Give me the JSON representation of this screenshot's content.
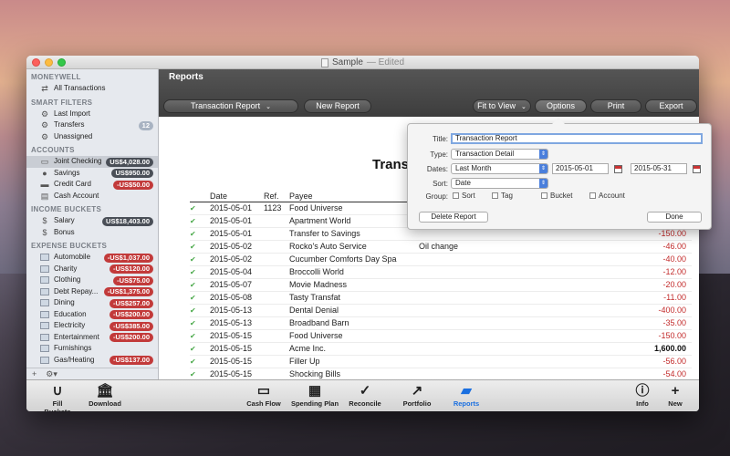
{
  "window": {
    "title": "Sample",
    "title_status": "— Edited"
  },
  "sidebar": {
    "app_header": "MONEYWELL",
    "all_transactions": "All Transactions",
    "smart_filters_header": "SMART FILTERS",
    "smart_filters": [
      {
        "label": "Last Import",
        "icon": "gear-icon"
      },
      {
        "label": "Transfers",
        "icon": "gear-icon",
        "count": "12"
      },
      {
        "label": "Unassigned",
        "icon": "gear-icon"
      }
    ],
    "accounts_header": "ACCOUNTS",
    "accounts": [
      {
        "label": "Joint Checking",
        "amount": "US$4,028.00",
        "tone": "dark",
        "icon": "checkbook-icon"
      },
      {
        "label": "Savings",
        "amount": "US$950.00",
        "tone": "dark",
        "icon": "piggy-bank-icon"
      },
      {
        "label": "Credit Card",
        "amount": "-US$50.00",
        "tone": "red",
        "icon": "credit-card-icon"
      },
      {
        "label": "Cash Account",
        "amount": "",
        "tone": "",
        "icon": "cash-icon"
      }
    ],
    "income_header": "INCOME BUCKETS",
    "income": [
      {
        "label": "Salary",
        "amount": "US$18,403.00",
        "tone": "dark"
      },
      {
        "label": "Bonus",
        "amount": "",
        "tone": ""
      }
    ],
    "expense_header": "EXPENSE BUCKETS",
    "expenses": [
      {
        "label": "Automobile",
        "amount": "-US$1,037.00",
        "tone": "red"
      },
      {
        "label": "Charity",
        "amount": "-US$120.00",
        "tone": "red"
      },
      {
        "label": "Clothing",
        "amount": "-US$75.00",
        "tone": "red"
      },
      {
        "label": "Debt Repay...",
        "amount": "-US$1,375.00",
        "tone": "red"
      },
      {
        "label": "Dining",
        "amount": "-US$257.00",
        "tone": "red"
      },
      {
        "label": "Education",
        "amount": "-US$200.00",
        "tone": "red"
      },
      {
        "label": "Electricity",
        "amount": "-US$385.00",
        "tone": "red"
      },
      {
        "label": "Entertainment",
        "amount": "-US$200.00",
        "tone": "red"
      },
      {
        "label": "Furnishings",
        "amount": "",
        "tone": ""
      },
      {
        "label": "Gas/Heating",
        "amount": "-US$137.00",
        "tone": "red"
      }
    ],
    "bottom_add": "+",
    "bottom_gear": "⚙▾"
  },
  "main": {
    "title": "Reports",
    "toolbar": {
      "report_select": "Transaction Report",
      "new_report": "New Report",
      "fit_to_view": "Fit to View",
      "options": "Options",
      "print": "Print",
      "export": "Export"
    },
    "report_title": "Transa",
    "columns": [
      "Date",
      "Ref.",
      "Payee"
    ],
    "rows": [
      {
        "date": "2015-05-01",
        "ref": "1123",
        "payee": "Food Universe",
        "memo": "",
        "amount": ""
      },
      {
        "date": "2015-05-01",
        "ref": "",
        "payee": "Apartment World",
        "memo": "",
        "amount": ""
      },
      {
        "date": "2015-05-01",
        "ref": "",
        "payee": "Transfer to Savings",
        "memo": "",
        "amount": "-150.00"
      },
      {
        "date": "2015-05-02",
        "ref": "",
        "payee": "Rocko's Auto Service",
        "memo": "Oil change",
        "amount": "-46.00"
      },
      {
        "date": "2015-05-02",
        "ref": "",
        "payee": "Cucumber Comforts Day Spa",
        "memo": "",
        "amount": "-40.00"
      },
      {
        "date": "2015-05-04",
        "ref": "",
        "payee": "Broccolli World",
        "memo": "",
        "amount": "-12.00"
      },
      {
        "date": "2015-05-07",
        "ref": "",
        "payee": "Movie Madness",
        "memo": "",
        "amount": "-20.00"
      },
      {
        "date": "2015-05-08",
        "ref": "",
        "payee": "Tasty Transfat",
        "memo": "",
        "amount": "-11.00"
      },
      {
        "date": "2015-05-13",
        "ref": "",
        "payee": "Dental Denial",
        "memo": "",
        "amount": "-400.00"
      },
      {
        "date": "2015-05-13",
        "ref": "",
        "payee": "Broadband Barn",
        "memo": "",
        "amount": "-35.00"
      },
      {
        "date": "2015-05-15",
        "ref": "",
        "payee": "Food Universe",
        "memo": "",
        "amount": "-150.00"
      },
      {
        "date": "2015-05-15",
        "ref": "",
        "payee": "Acme Inc.",
        "memo": "",
        "amount": "1,600.00"
      },
      {
        "date": "2015-05-15",
        "ref": "",
        "payee": "Filler Up",
        "memo": "",
        "amount": "-56.00"
      },
      {
        "date": "2015-05-15",
        "ref": "",
        "payee": "Shocking Bills",
        "memo": "",
        "amount": "-54.00"
      }
    ]
  },
  "options_popover": {
    "title_label": "Title:",
    "title_value": "Transaction Report",
    "type_label": "Type:",
    "type_value": "Transaction Detail",
    "dates_label": "Dates:",
    "dates_value": "Last Month",
    "date_from": "2015-05-01",
    "date_to": "2015-05-31",
    "sort_label": "Sort:",
    "sort_value": "Date",
    "group_label": "Group:",
    "group_options": [
      "Sort",
      "Tag",
      "Bucket",
      "Account"
    ],
    "delete_button": "Delete Report",
    "done_button": "Done"
  },
  "bottom_bar": {
    "fill_buckets": "Fill Buckets",
    "download": "Download",
    "cash_flow": "Cash Flow",
    "spending_plan": "Spending Plan",
    "reconcile": "Reconcile",
    "portfolio": "Portfolio",
    "reports": "Reports",
    "info": "Info",
    "new": "New"
  }
}
